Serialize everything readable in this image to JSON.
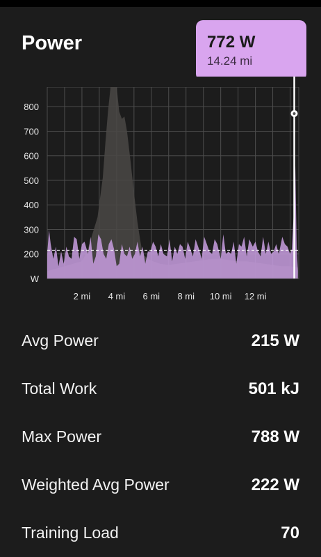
{
  "header": {
    "title": "Power"
  },
  "tooltip": {
    "value": "772 W",
    "distance": "14.24 mi",
    "color": "#d9a5ef"
  },
  "colors": {
    "primary_series": "#c89ee0",
    "secondary_series": "#4a4845",
    "average_line": "#ffffff",
    "grid": "#4d4d4d"
  },
  "chart_data": {
    "type": "area",
    "xlabel": "",
    "ylabel": "",
    "x_unit": "mi",
    "y_tick_labels": [
      "W",
      "200",
      "300",
      "400",
      "500",
      "600",
      "700",
      "800"
    ],
    "x_tick_labels": [
      "2 mi",
      "4 mi",
      "6 mi",
      "8 mi",
      "10 mi",
      "12 mi"
    ],
    "y_ticks": [
      100,
      200,
      300,
      400,
      500,
      600,
      700,
      800
    ],
    "x_ticks": [
      2,
      4,
      6,
      8,
      10,
      12
    ],
    "xlim": [
      0,
      14.5
    ],
    "ylim": [
      100,
      880
    ],
    "average": 215,
    "cursor": {
      "x": 14.24,
      "y": 772
    },
    "grid": true,
    "series": [
      {
        "values": [
          [
            0.0,
            200
          ],
          [
            0.1,
            300
          ],
          [
            0.2,
            240
          ],
          [
            0.35,
            180
          ],
          [
            0.5,
            230
          ],
          [
            0.65,
            150
          ],
          [
            0.8,
            210
          ],
          [
            0.95,
            160
          ],
          [
            1.1,
            230
          ],
          [
            1.25,
            190
          ],
          [
            1.4,
            180
          ],
          [
            1.55,
            270
          ],
          [
            1.7,
            260
          ],
          [
            1.85,
            180
          ],
          [
            2.0,
            240
          ],
          [
            2.15,
            250
          ],
          [
            2.35,
            200
          ],
          [
            2.5,
            270
          ],
          [
            2.65,
            160
          ],
          [
            2.8,
            190
          ],
          [
            2.95,
            280
          ],
          [
            3.1,
            260
          ],
          [
            3.25,
            200
          ],
          [
            3.4,
            180
          ],
          [
            3.55,
            240
          ],
          [
            3.7,
            260
          ],
          [
            3.85,
            220
          ],
          [
            4.0,
            150
          ],
          [
            4.15,
            160
          ],
          [
            4.3,
            240
          ],
          [
            4.45,
            200
          ],
          [
            4.6,
            190
          ],
          [
            4.75,
            230
          ],
          [
            4.9,
            180
          ],
          [
            5.05,
            200
          ],
          [
            5.2,
            250
          ],
          [
            5.35,
            190
          ],
          [
            5.5,
            230
          ],
          [
            5.65,
            160
          ],
          [
            5.8,
            210
          ],
          [
            5.95,
            210
          ],
          [
            6.1,
            250
          ],
          [
            6.25,
            230
          ],
          [
            6.4,
            190
          ],
          [
            6.55,
            240
          ],
          [
            6.7,
            200
          ],
          [
            6.9,
            190
          ],
          [
            7.05,
            260
          ],
          [
            7.2,
            170
          ],
          [
            7.35,
            230
          ],
          [
            7.5,
            200
          ],
          [
            7.65,
            240
          ],
          [
            7.8,
            230
          ],
          [
            7.95,
            180
          ],
          [
            8.1,
            250
          ],
          [
            8.25,
            220
          ],
          [
            8.4,
            190
          ],
          [
            8.55,
            260
          ],
          [
            8.75,
            220
          ],
          [
            8.9,
            180
          ],
          [
            9.05,
            270
          ],
          [
            9.2,
            240
          ],
          [
            9.35,
            210
          ],
          [
            9.5,
            200
          ],
          [
            9.65,
            260
          ],
          [
            9.8,
            240
          ],
          [
            10.0,
            180
          ],
          [
            10.15,
            280
          ],
          [
            10.3,
            200
          ],
          [
            10.45,
            210
          ],
          [
            10.6,
            200
          ],
          [
            10.75,
            250
          ],
          [
            10.9,
            160
          ],
          [
            11.05,
            240
          ],
          [
            11.2,
            230
          ],
          [
            11.35,
            270
          ],
          [
            11.5,
            190
          ],
          [
            11.65,
            260
          ],
          [
            11.85,
            230
          ],
          [
            12.0,
            250
          ],
          [
            12.15,
            210
          ],
          [
            12.3,
            190
          ],
          [
            12.45,
            270
          ],
          [
            12.6,
            200
          ],
          [
            12.75,
            250
          ],
          [
            12.9,
            200
          ],
          [
            13.05,
            210
          ],
          [
            13.2,
            240
          ],
          [
            13.35,
            200
          ],
          [
            13.55,
            270
          ],
          [
            13.7,
            240
          ],
          [
            13.85,
            230
          ],
          [
            14.0,
            200
          ],
          [
            14.1,
            220
          ],
          [
            14.2,
            350
          ],
          [
            14.3,
            560
          ],
          [
            14.38,
            230
          ],
          [
            14.45,
            130
          ]
        ]
      },
      {
        "values": [
          [
            0.0,
            130
          ],
          [
            0.5,
            140
          ],
          [
            1.0,
            150
          ],
          [
            1.5,
            160
          ],
          [
            2.0,
            170
          ],
          [
            2.3,
            210
          ],
          [
            2.6,
            280
          ],
          [
            2.9,
            350
          ],
          [
            3.05,
            430
          ],
          [
            3.2,
            510
          ],
          [
            3.35,
            650
          ],
          [
            3.5,
            780
          ],
          [
            3.65,
            880
          ],
          [
            3.8,
            900
          ],
          [
            4.0,
            880
          ],
          [
            4.15,
            780
          ],
          [
            4.3,
            750
          ],
          [
            4.45,
            760
          ],
          [
            4.6,
            700
          ],
          [
            4.8,
            580
          ],
          [
            5.0,
            450
          ],
          [
            5.2,
            330
          ],
          [
            5.35,
            260
          ],
          [
            5.5,
            200
          ],
          [
            5.8,
            180
          ],
          [
            6.1,
            170
          ],
          [
            6.5,
            160
          ],
          [
            7.0,
            155
          ],
          [
            7.5,
            160
          ],
          [
            8.0,
            165
          ],
          [
            8.5,
            170
          ],
          [
            9.0,
            175
          ],
          [
            9.5,
            180
          ],
          [
            10.0,
            180
          ],
          [
            10.5,
            175
          ],
          [
            11.0,
            170
          ],
          [
            11.5,
            170
          ],
          [
            12.0,
            165
          ],
          [
            12.5,
            160
          ],
          [
            13.0,
            155
          ],
          [
            13.5,
            150
          ],
          [
            14.0,
            150
          ],
          [
            14.45,
            145
          ]
        ]
      }
    ]
  },
  "stats": [
    {
      "label": "Avg Power",
      "value": "215 W"
    },
    {
      "label": "Total Work",
      "value": "501 kJ"
    },
    {
      "label": "Max Power",
      "value": "788 W"
    },
    {
      "label": "Weighted Avg Power",
      "value": "222 W"
    },
    {
      "label": "Training Load",
      "value": "70"
    }
  ]
}
